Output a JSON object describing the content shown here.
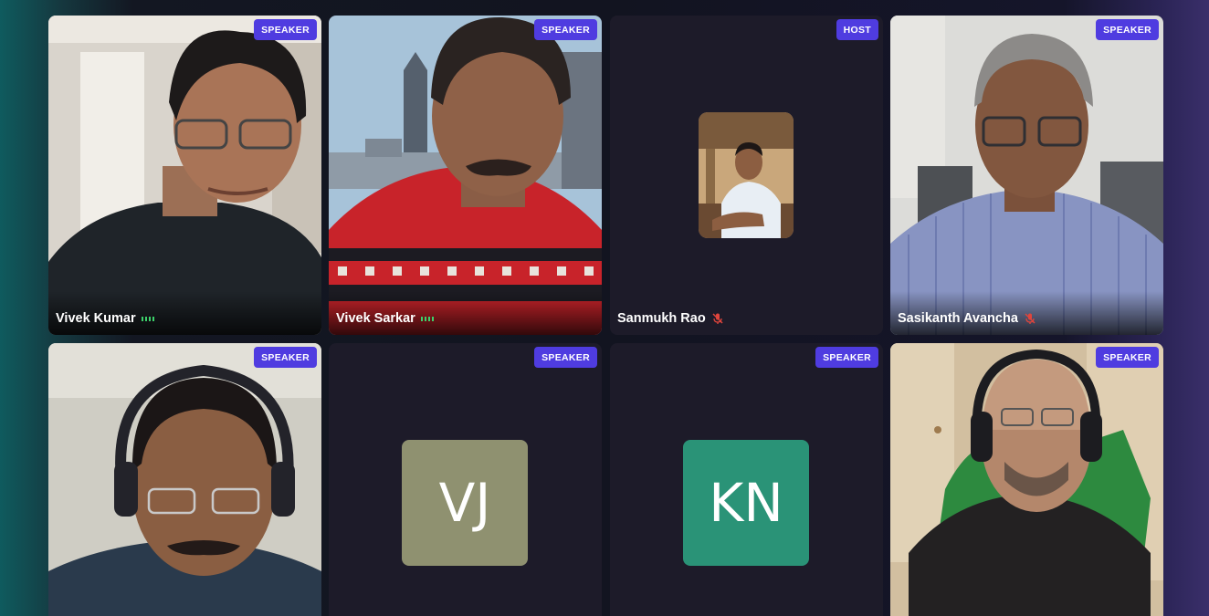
{
  "participants": [
    {
      "name": "Vivek Kumar",
      "badge": "SPEAKER",
      "audio": "speaking"
    },
    {
      "name": "Vivek Sarkar",
      "badge": "SPEAKER",
      "audio": "speaking"
    },
    {
      "name": "Sanmukh Rao",
      "badge": "HOST",
      "audio": "muted"
    },
    {
      "name": "Sasikanth Avancha",
      "badge": "SPEAKER",
      "audio": "muted"
    },
    {
      "name": "",
      "badge": "SPEAKER"
    },
    {
      "name": "",
      "badge": "SPEAKER",
      "initials": "VJ",
      "avatar_color": "#8f9170"
    },
    {
      "name": "",
      "badge": "SPEAKER",
      "initials": "KN",
      "avatar_color": "#2a9377"
    },
    {
      "name": "",
      "badge": "SPEAKER"
    }
  ],
  "colors": {
    "badge": "#4f3ce0",
    "speaking": "#3cd16a",
    "muted": "#e0453c"
  }
}
